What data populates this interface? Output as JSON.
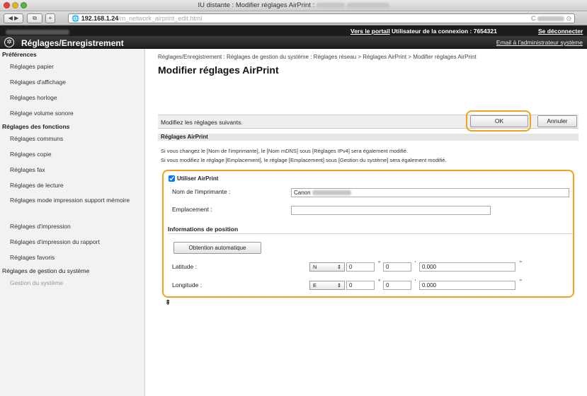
{
  "window": {
    "title": "IU distante : Modifier réglages AirPrint :",
    "url_host": "192.168.1.24",
    "url_path": "/m_network_airprint_edit.html",
    "url_right": "C"
  },
  "topbar": {
    "portal_link": "Vers le portail",
    "user_label": "Utilisateur de la connexion : 7654321",
    "logout_link": "Se déconnecter"
  },
  "app": {
    "icon": "gear-circle-icon",
    "title": "Réglages/Enregistrement",
    "mail_link": "Email à l'administrateur système"
  },
  "sidebar": {
    "sections": [
      {
        "heading": "Préférences",
        "items": [
          "Réglages papier",
          "Réglages d'affichage",
          "Réglages horloge",
          "Réglage volume sonore"
        ]
      },
      {
        "heading": "Réglages des fonctions",
        "items": [
          "Réglages communs",
          "Réglages copie",
          "Réglages fax",
          "Réglages de lecture",
          "Réglages mode impression support mémoire",
          "Réglages d'impression",
          "Réglages d'impression du rapport",
          "Réglages favoris"
        ]
      },
      {
        "heading": "Réglages de gestion du système",
        "items": [
          "Gestion du système"
        ]
      }
    ]
  },
  "main": {
    "breadcrumb": "Réglages/Enregistrement : Réglages de gestion du système : Réglages réseau > Réglages AirPrint > Modifier réglages AirPrint",
    "title": "Modifier réglages AirPrint",
    "instruction": "Modifiez les réglages suivants.",
    "ok_label": "OK",
    "cancel_label": "Annuler",
    "section_title": "Réglages AirPrint",
    "note1": "Si vous changez le [Nom de l'imprimante], le [Nom mDNS] sous [Réglages IPv4] sera également modifié.",
    "note2": "Si vous modifiez le réglage [Emplacement], le réglage [Emplacement] sous [Gestion du système] sera également modifié.",
    "use_airprint_label": "Utiliser AirPrint",
    "use_airprint_checked": true,
    "printer_name_label": "Nom de l'imprimante :",
    "printer_name_value": "Canon",
    "location_label": "Emplacement :",
    "location_value": "",
    "position_heading": "Informations de position",
    "auto_button": "Obtention automatique",
    "latitude_label": "Latitude :",
    "latitude_dir": "N",
    "latitude_deg": "0",
    "latitude_min": "0",
    "latitude_sec": "0.000",
    "longitude_label": "Longitude :",
    "longitude_dir": "E",
    "longitude_deg": "0",
    "longitude_min": "0",
    "longitude_sec": "0.000",
    "deg_symbol": "°",
    "min_symbol": "'",
    "sec_symbol": "\""
  },
  "colors": {
    "highlight": "#f3a21b",
    "topbar": "#1c1c1c"
  }
}
